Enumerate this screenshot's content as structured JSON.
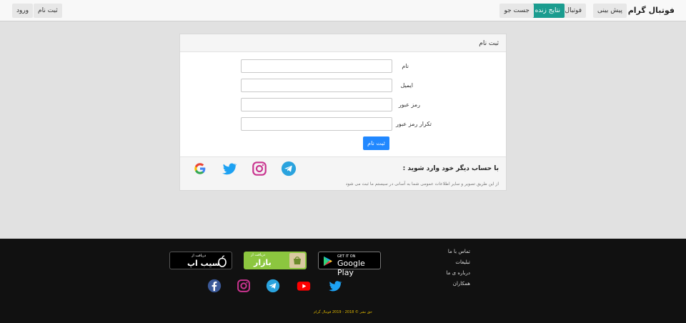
{
  "navbar": {
    "brand": "فوتبال گرام",
    "items": [
      {
        "label": "پیش بینی"
      },
      {
        "label": "فوتبال فانتزی"
      },
      {
        "label": "نتایج زنده"
      },
      {
        "label": "جست جو"
      }
    ],
    "auth": {
      "register": "ثبت نام",
      "login": "ورود"
    }
  },
  "register_form": {
    "header": "ثبت نام",
    "fields": [
      {
        "label": "نام",
        "value": ""
      },
      {
        "label": "ایمیل",
        "value": ""
      },
      {
        "label": "رمز عبور",
        "value": ""
      },
      {
        "label": "تکرار رمز عبور",
        "value": ""
      }
    ],
    "submit_label": "ثبت نام"
  },
  "social_login": {
    "title": "با حساب دیگر خود وارد شوید :",
    "description": "از این طریق تصویر و سایر اطلاعات عمومی شما به آسانی در سیستم ما ثبت می شود",
    "icons": [
      "telegram-icon",
      "instagram-icon",
      "twitter-icon",
      "google-icon"
    ]
  },
  "footer": {
    "links": [
      "تماس با ما",
      "تبلیغات",
      "درباره ی ما",
      "همکاران"
    ],
    "badges": {
      "google_play_small": "GET IT ON",
      "google_play_big": "Google Play",
      "bazaar_small": "دریافت از",
      "bazaar_big": "بازار",
      "sibapp_small": "دریافت از",
      "sibapp_big": "سیب اپ"
    },
    "social_icons": [
      "twitter-icon",
      "youtube-icon",
      "telegram-icon",
      "instagram-icon",
      "facebook-icon"
    ],
    "copyright": "حق نشر © 2018 - 2019 فوتبال گرام"
  },
  "colors": {
    "accent": "#1a9c8f",
    "primary_button": "#2188ff",
    "footer_bg": "#111111",
    "copyright": "#e0b800"
  }
}
